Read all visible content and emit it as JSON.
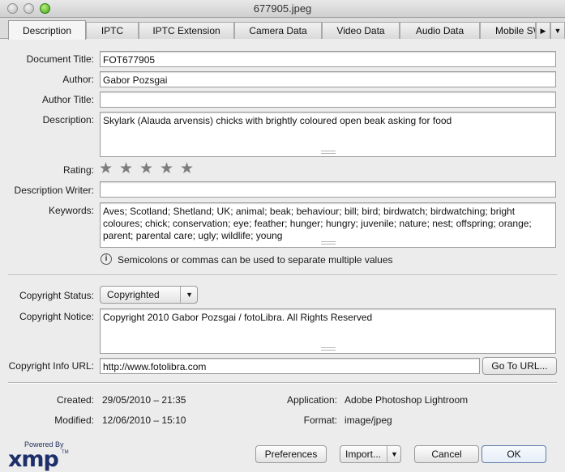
{
  "window": {
    "title": "677905.jpeg"
  },
  "tabs": [
    {
      "label": "Description",
      "active": true
    },
    {
      "label": "IPTC",
      "active": false
    },
    {
      "label": "IPTC Extension",
      "active": false
    },
    {
      "label": "Camera Data",
      "active": false
    },
    {
      "label": "Video Data",
      "active": false
    },
    {
      "label": "Audio Data",
      "active": false
    },
    {
      "label": "Mobile SW",
      "active": false
    }
  ],
  "tab_scroll": {
    "right_glyph": "▶",
    "down_glyph": "▼"
  },
  "form": {
    "document_title": {
      "label": "Document Title:",
      "value": "FOT677905"
    },
    "author": {
      "label": "Author:",
      "value": "Gabor Pozsgai"
    },
    "author_title": {
      "label": "Author Title:",
      "value": ""
    },
    "description": {
      "label": "Description:",
      "value": "Skylark (Alauda arvensis) chicks with brightly coloured open beak asking for food"
    },
    "rating": {
      "label": "Rating:",
      "stars": 0,
      "max": 5
    },
    "description_writer": {
      "label": "Description Writer:",
      "value": ""
    },
    "keywords": {
      "label": "Keywords:",
      "value": "Aves; Scotland; Shetland; UK; animal; beak; behaviour; bill; bird; birdwatch; birdwatching; bright coloures; chick; conservation; eye; feather; hunger; hungry; juvenile; nature; nest; offspring; orange; parent; parental care; ugly; wildlife; young"
    },
    "hint": "Semicolons or commas can be used to separate multiple values",
    "copyright_status": {
      "label": "Copyright Status:",
      "value": "Copyrighted"
    },
    "copyright_notice": {
      "label": "Copyright Notice:",
      "value": "Copyright 2010 Gabor Pozsgai / fotoLibra. All Rights Reserved"
    },
    "copyright_url": {
      "label": "Copyright Info URL:",
      "value": "http://www.fotolibra.com",
      "button": "Go To URL..."
    }
  },
  "metadata": {
    "created": {
      "label": "Created:",
      "value": "29/05/2010 – 21:35"
    },
    "modified": {
      "label": "Modified:",
      "value": "12/06/2010 – 15:10"
    },
    "application": {
      "label": "Application:",
      "value": "Adobe Photoshop Lightroom"
    },
    "format": {
      "label": "Format:",
      "value": "image/jpeg"
    }
  },
  "footer": {
    "powered_by": "Powered By",
    "logo": "xmp",
    "logo_tm": "TM",
    "preferences": "Preferences",
    "import": "Import...",
    "cancel": "Cancel",
    "ok": "OK"
  },
  "colors": {
    "logo": "#1d2f6a",
    "ok_border": "#5c7ca8"
  }
}
